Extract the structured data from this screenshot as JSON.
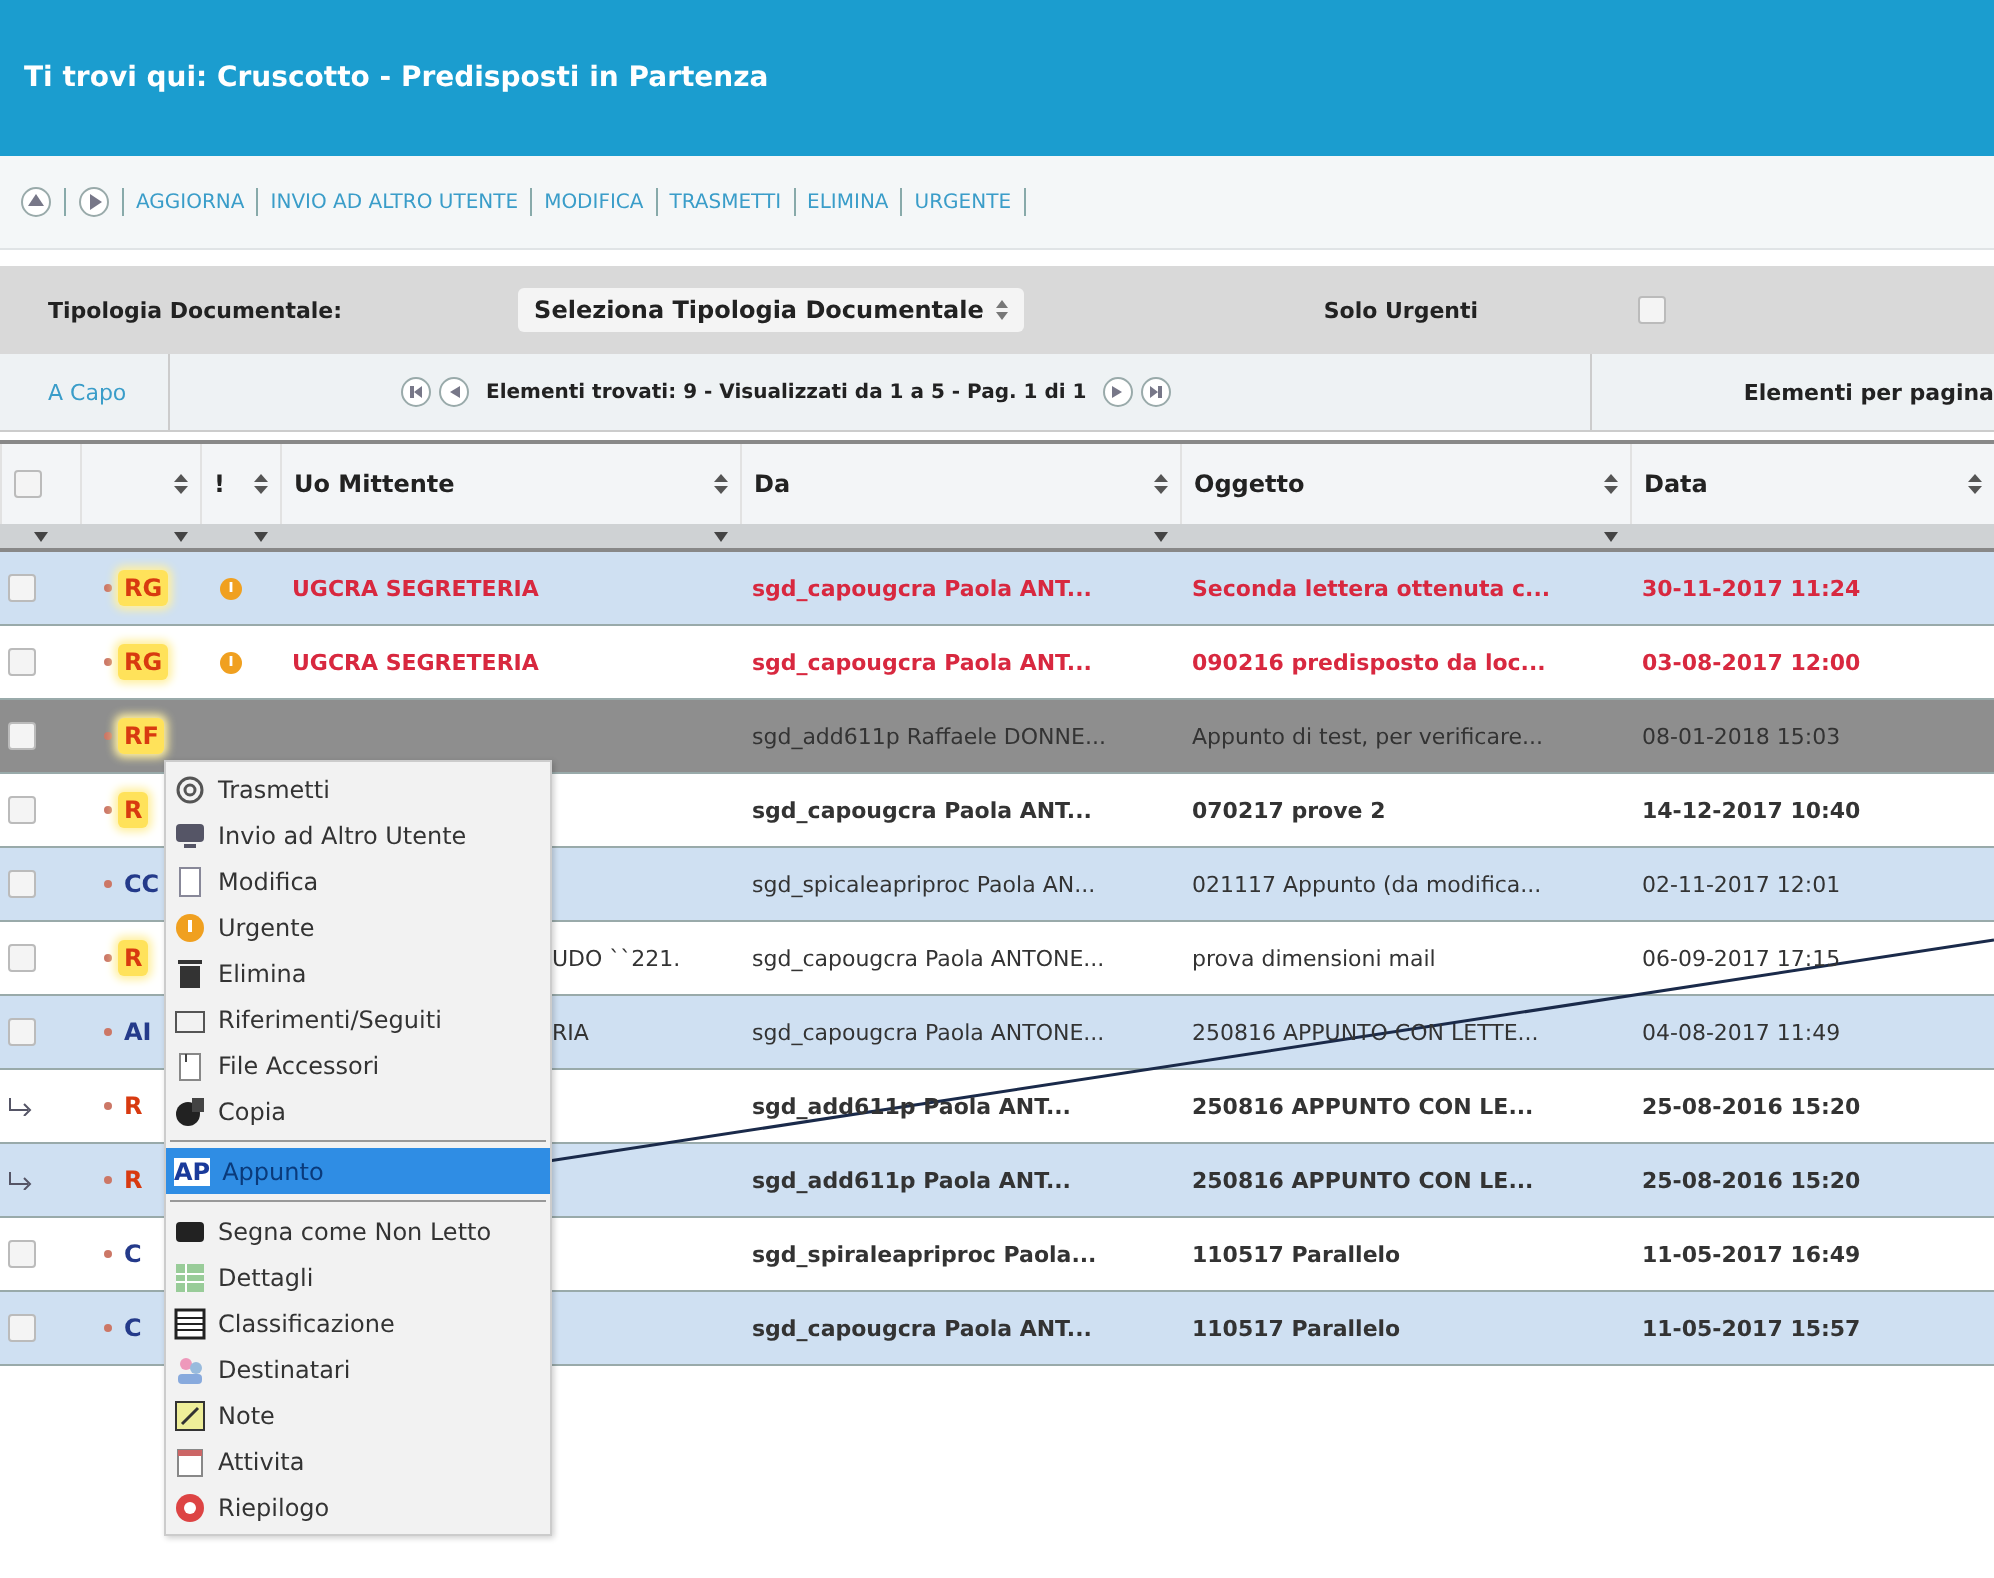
{
  "header": {
    "title": "Ti trovi qui: Cruscotto - Predisposti in Partenza"
  },
  "toolbar": {
    "actions": [
      "AGGIORNA",
      "INVIO AD ALTRO UTENTE",
      "MODIFICA",
      "TRASMETTI",
      "ELIMINA",
      "URGENTE"
    ]
  },
  "filters": {
    "label": "Tipologia Documentale:",
    "select": "Seleziona Tipologia Documentale",
    "urgent_label": "Solo Urgenti",
    "urgent_checked": false
  },
  "pager": {
    "link": "A Capo",
    "summary": "Elementi trovati: 9 - Visualizzati da 1 a 5 - Pag. 1 di 1",
    "per_page_label": "Elementi per pagina"
  },
  "table": {
    "select_all_checked": false,
    "columns": [
      "!",
      "Uo Mittente",
      "Da",
      "Oggetto",
      "Data"
    ],
    "rows": [
      {
        "kind": "checkbox",
        "checked": false,
        "badge": {
          "text": "RG",
          "highlighted": true,
          "color": "#d83a10"
        },
        "urgent": true,
        "uo": "UGCRA SEGRETERIA",
        "da": "sgd_capougcra Paola ANT...",
        "oggetto": "Seconda lettera ottenuta c...",
        "data": "30-11-2017 11:24",
        "unread": true,
        "selected": false
      },
      {
        "kind": "checkbox",
        "checked": false,
        "badge": {
          "text": "RG",
          "highlighted": true,
          "color": "#d83a10"
        },
        "urgent": true,
        "uo": "UGCRA SEGRETERIA",
        "da": "sgd_capougcra Paola ANT...",
        "oggetto": "090216 predisposto da loc...",
        "data": "03-08-2017 12:00",
        "unread": true,
        "selected": false
      },
      {
        "kind": "checkbox",
        "checked": false,
        "badge": {
          "text": "RF",
          "highlighted": true,
          "color": "#d83a10"
        },
        "urgent": false,
        "da": "sgd_add611p Raffaele DONNE...",
        "oggetto": "Appunto di test, per verificare...",
        "data": "08-01-2018 15:03",
        "unread": false,
        "selected": true
      },
      {
        "kind": "checkbox",
        "checked": false,
        "badge": {
          "text": "R",
          "highlighted": true,
          "color": "#d83a10"
        },
        "urgent": false,
        "da": "sgd_capougcra Paola ANT...",
        "oggetto": "070217 prove 2",
        "data": "14-12-2017 10:40",
        "unread": true,
        "selected": false
      },
      {
        "kind": "checkbox",
        "checked": false,
        "badge": {
          "text": "CC",
          "highlighted": false,
          "color": "#243a8a"
        },
        "urgent": false,
        "da": "sgd_spicaleapriproc Paola AN...",
        "oggetto": "021117 Appunto (da modifica...",
        "data": "02-11-2017 12:01",
        "unread": false,
        "selected": false
      },
      {
        "kind": "checkbox",
        "checked": false,
        "badge": {
          "text": "R",
          "highlighted": true,
          "color": "#d83a10"
        },
        "urgent": false,
        "uo": "UDO ``221.",
        "da": "sgd_capougcra Paola ANTONE...",
        "oggetto": "prova dimensioni mail",
        "data": "06-09-2017 17:15",
        "unread": false,
        "selected": false
      },
      {
        "kind": "checkbox",
        "checked": false,
        "badge": {
          "text": "AI",
          "highlighted": false,
          "color": "#243a8a"
        },
        "urgent": false,
        "uo": "RIA",
        "da": "sgd_capougcra Paola ANTONE...",
        "oggetto": "250816 APPUNTO CON LETTE...",
        "data": "04-08-2017 11:49",
        "unread": false,
        "selected": false
      },
      {
        "kind": "reply",
        "badge": {
          "text": "R",
          "highlighted": false,
          "color": "#d83a10"
        },
        "urgent": false,
        "da": "sgd_add611p Paola ANT...",
        "oggetto": "250816 APPUNTO CON LE...",
        "data": "25-08-2016 15:20",
        "unread": true,
        "selected": false
      },
      {
        "kind": "reply",
        "badge": {
          "text": "R",
          "highlighted": false,
          "color": "#d83a10"
        },
        "urgent": false,
        "da": "sgd_add611p Paola ANT...",
        "oggetto": "250816 APPUNTO CON LE...",
        "data": "25-08-2016 15:20",
        "unread": true,
        "selected": false
      },
      {
        "kind": "checkbox",
        "checked": false,
        "badge": {
          "text": "C",
          "highlighted": false,
          "color": "#243a8a"
        },
        "urgent": false,
        "da": "sgd_spiraleapriproc Paola...",
        "oggetto": "110517 Parallelo",
        "data": "11-05-2017 16:49",
        "unread": true,
        "selected": false
      },
      {
        "kind": "checkbox",
        "checked": false,
        "badge": {
          "text": "C",
          "highlighted": false,
          "color": "#243a8a"
        },
        "urgent": false,
        "da": "sgd_capougcra Paola ANT...",
        "oggetto": "110517 Parallelo",
        "data": "11-05-2017 15:57",
        "unread": true,
        "selected": false
      }
    ]
  },
  "context_menu": {
    "items": [
      {
        "kind": "item",
        "label": "Trasmetti",
        "selected": false
      },
      {
        "kind": "item",
        "label": "Invio ad Altro Utente",
        "selected": false
      },
      {
        "kind": "item",
        "label": "Modifica",
        "selected": false
      },
      {
        "kind": "item",
        "label": "Urgente",
        "selected": false
      },
      {
        "kind": "item",
        "label": "Elimina",
        "selected": false
      },
      {
        "kind": "item",
        "label": "Riferimenti/Seguiti",
        "selected": false
      },
      {
        "kind": "item",
        "label": "File Accessori",
        "selected": false
      },
      {
        "kind": "item",
        "label": "Copia",
        "selected": false
      },
      {
        "kind": "separator"
      },
      {
        "kind": "item",
        "icon_text": "AP",
        "label": "Appunto",
        "selected": true
      },
      {
        "kind": "separator"
      },
      {
        "kind": "item",
        "label": "Segna come Non Letto",
        "selected": false
      },
      {
        "kind": "item",
        "label": "Dettagli",
        "selected": false
      },
      {
        "kind": "item",
        "label": "Classificazione",
        "selected": false
      },
      {
        "kind": "item",
        "label": "Destinatari",
        "selected": false
      },
      {
        "kind": "item",
        "label": "Note",
        "selected": false
      },
      {
        "kind": "item",
        "label": "Attivita",
        "selected": false
      },
      {
        "kind": "item",
        "label": "Riepilogo",
        "selected": false
      }
    ]
  }
}
